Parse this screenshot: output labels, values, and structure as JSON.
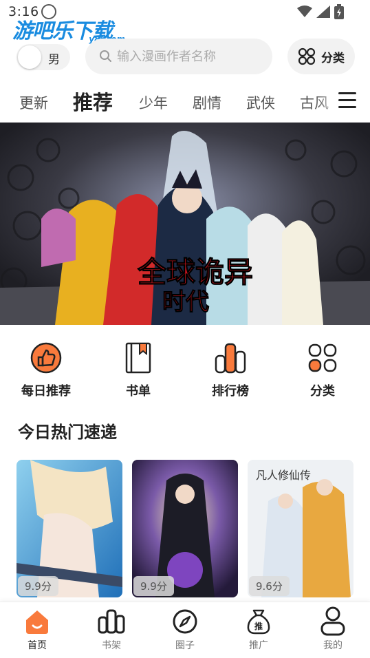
{
  "status_bar": {
    "time": "3:16"
  },
  "watermark": {
    "main": "游吧乐下载",
    "sub": "y8l.com"
  },
  "header": {
    "gender_label": "男",
    "search_placeholder": "输入漫画作者名称",
    "category_label": "分类"
  },
  "tabs": [
    {
      "label": "更新"
    },
    {
      "label": "推荐"
    },
    {
      "label": "少年"
    },
    {
      "label": "剧情"
    },
    {
      "label": "武侠"
    },
    {
      "label": "古风"
    }
  ],
  "banner": {
    "title_art": "全球诡异时代"
  },
  "quick_entries": [
    {
      "label": "每日推荐"
    },
    {
      "label": "书单"
    },
    {
      "label": "排行榜"
    },
    {
      "label": "分类"
    }
  ],
  "section": {
    "title": "今日热门速递"
  },
  "cards": [
    {
      "score": "9.9分"
    },
    {
      "score": "9.9分"
    },
    {
      "score": "9.6分"
    }
  ],
  "bottom_nav": [
    {
      "label": "首页"
    },
    {
      "label": "书架"
    },
    {
      "label": "圈子"
    },
    {
      "label": "推广"
    },
    {
      "label": "我的"
    }
  ],
  "colors": {
    "accent": "#f97a3c",
    "watermark": "#1a8ce0"
  }
}
